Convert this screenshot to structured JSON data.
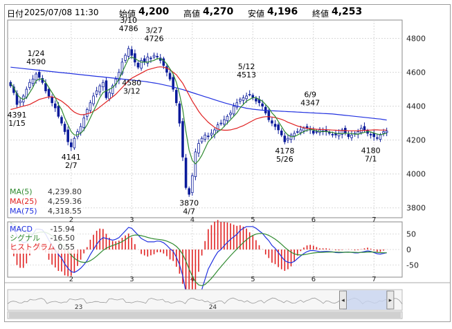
{
  "header": {
    "date_label": "日付",
    "datetime": "2025/07/08 11:30",
    "open_label": "始値",
    "open": "4,200",
    "high_label": "高値",
    "high": "4,270",
    "low_label": "安値",
    "low": "4,196",
    "close_label": "終値",
    "close": "4,253"
  },
  "colors": {
    "up_candle": "#ffffff",
    "down_candle": "#0a1a9a",
    "ma5": "#2f8a2f",
    "ma25": "#e02020",
    "ma75": "#2030e0",
    "macd": "#2030e0",
    "signal": "#2f8a2f",
    "histogram": "#e02020"
  },
  "chart_data": [
    {
      "type": "candlestick",
      "ylim": [
        3750,
        4900
      ],
      "y_ticks": [
        "4800",
        "4600",
        "4400",
        "4200",
        "4000",
        "3800"
      ],
      "x_ticks": [
        "2",
        "3",
        "4",
        "5",
        "6",
        "7"
      ],
      "legend": [
        {
          "name": "MA(5)",
          "value": "4,239.80"
        },
        {
          "name": "MA(25)",
          "value": "4,259.36"
        },
        {
          "name": "MA(75)",
          "value": "4,318.55"
        }
      ],
      "annotations": [
        {
          "date": "1/15",
          "value": "4391"
        },
        {
          "date": "1/24",
          "value": "4590"
        },
        {
          "date": "2/7",
          "value": "4141"
        },
        {
          "date": "3/10",
          "value": "4786"
        },
        {
          "date": "3/12",
          "value": "4580"
        },
        {
          "date": "3/27",
          "value": "4726"
        },
        {
          "date": "4/7",
          "value": "3870"
        },
        {
          "date": "5/12",
          "value": "4513"
        },
        {
          "date": "5/26",
          "value": "4178"
        },
        {
          "date": "6/9",
          "value": "4347"
        },
        {
          "date": "7/1",
          "value": "4180"
        }
      ],
      "closes": [
        4520,
        4480,
        4410,
        4430,
        4460,
        4500,
        4540,
        4560,
        4590,
        4570,
        4540,
        4490,
        4460,
        4420,
        4390,
        4340,
        4300,
        4250,
        4190,
        4160,
        4210,
        4250,
        4280,
        4330,
        4380,
        4420,
        4460,
        4490,
        4520,
        4540,
        4450,
        4480,
        4520,
        4560,
        4600,
        4660,
        4700,
        4740,
        4700,
        4660,
        4630,
        4670,
        4660,
        4690,
        4680,
        4700,
        4690,
        4670,
        4640,
        4600,
        4560,
        4500,
        4420,
        4300,
        4100,
        3920,
        3880,
        3990,
        4130,
        4180,
        4210,
        4230,
        4220,
        4240,
        4260,
        4290,
        4300,
        4320,
        4340,
        4360,
        4400,
        4420,
        4440,
        4450,
        4460,
        4470,
        4450,
        4430,
        4420,
        4400,
        4360,
        4320,
        4300,
        4280,
        4260,
        4230,
        4190,
        4210,
        4230,
        4240,
        4250,
        4260,
        4270,
        4270,
        4260,
        4240,
        4250,
        4260,
        4250,
        4250,
        4240,
        4230,
        4230,
        4240,
        4260,
        4240,
        4220,
        4230,
        4240,
        4250,
        4270,
        4260,
        4240,
        4230,
        4220,
        4210,
        4230,
        4250,
        4253
      ],
      "ma5": [
        4535,
        4510,
        4470,
        4450,
        4440,
        4450,
        4480,
        4510,
        4550,
        4560,
        4560,
        4540,
        4510,
        4480,
        4450,
        4410,
        4380,
        4330,
        4290,
        4250,
        4230,
        4230,
        4240,
        4260,
        4290,
        4330,
        4370,
        4410,
        4450,
        4480,
        4490,
        4500,
        4510,
        4530,
        4560,
        4600,
        4640,
        4680,
        4690,
        4680,
        4670,
        4660,
        4660,
        4660,
        4665,
        4670,
        4680,
        4680,
        4670,
        4650,
        4620,
        4590,
        4540,
        4470,
        4380,
        4250,
        4140,
        4080,
        4060,
        4080,
        4110,
        4150,
        4190,
        4210,
        4230,
        4250,
        4260,
        4280,
        4300,
        4320,
        4340,
        4360,
        4390,
        4410,
        4430,
        4440,
        4450,
        4450,
        4440,
        4430,
        4410,
        4390,
        4360,
        4340,
        4310,
        4280,
        4250,
        4230,
        4220,
        4220,
        4230,
        4240,
        4250,
        4258,
        4262,
        4260,
        4255,
        4250,
        4250,
        4250,
        4248,
        4245,
        4240,
        4238,
        4238,
        4240,
        4240,
        4238,
        4235,
        4235,
        4240,
        4245,
        4250,
        4248,
        4242,
        4235,
        4232,
        4236,
        4240
      ],
      "ma25": [
        4380,
        4385,
        4390,
        4395,
        4400,
        4405,
        4410,
        4420,
        4430,
        4440,
        4445,
        4450,
        4455,
        4455,
        4450,
        4440,
        4430,
        4415,
        4400,
        4380,
        4365,
        4355,
        4350,
        4350,
        4355,
        4360,
        4370,
        4380,
        4395,
        4410,
        4425,
        4440,
        4455,
        4470,
        4490,
        4510,
        4530,
        4550,
        4565,
        4575,
        4585,
        4595,
        4605,
        4615,
        4620,
        4625,
        4630,
        4632,
        4630,
        4625,
        4615,
        4600,
        4585,
        4560,
        4535,
        4500,
        4465,
        4430,
        4400,
        4370,
        4345,
        4325,
        4305,
        4290,
        4275,
        4265,
        4260,
        4258,
        4258,
        4260,
        4265,
        4270,
        4278,
        4285,
        4295,
        4305,
        4315,
        4325,
        4330,
        4335,
        4338,
        4338,
        4336,
        4333,
        4328,
        4322,
        4315,
        4305,
        4298,
        4290,
        4283,
        4278,
        4273,
        4270,
        4268,
        4266,
        4264,
        4263,
        4262,
        4261,
        4260,
        4259,
        4258,
        4257,
        4256,
        4256,
        4255,
        4255,
        4255,
        4255,
        4256,
        4257,
        4258,
        4259,
        4260,
        4260,
        4259,
        4259,
        4259
      ],
      "ma75": [
        4630,
        4628,
        4626,
        4624,
        4622,
        4620,
        4618,
        4616,
        4614,
        4612,
        4610,
        4608,
        4606,
        4604,
        4602,
        4600,
        4598,
        4596,
        4594,
        4592,
        4590,
        4588,
        4586,
        4584,
        4582,
        4580,
        4578,
        4576,
        4574,
        4572,
        4570,
        4568,
        4566,
        4564,
        4562,
        4560,
        4558,
        4556,
        4554,
        4552,
        4550,
        4548,
        4546,
        4543,
        4540,
        4537,
        4534,
        4530,
        4526,
        4522,
        4518,
        4513,
        4508,
        4503,
        4498,
        4492,
        4486,
        4480,
        4474,
        4468,
        4462,
        4456,
        4450,
        4444,
        4438,
        4432,
        4426,
        4420,
        4415,
        4410,
        4405,
        4400,
        4396,
        4392,
        4388,
        4385,
        4382,
        4380,
        4378,
        4376,
        4375,
        4374,
        4373,
        4372,
        4371,
        4370,
        4369,
        4368,
        4367,
        4366,
        4365,
        4364,
        4363,
        4362,
        4361,
        4360,
        4359,
        4358,
        4357,
        4356,
        4355,
        4354,
        4352,
        4350,
        4348,
        4346,
        4344,
        4342,
        4340,
        4338,
        4336,
        4334,
        4332,
        4330,
        4328,
        4326,
        4324,
        4321,
        4318
      ]
    },
    {
      "type": "macd",
      "ylim": [
        -85,
        85
      ],
      "y_ticks": [
        "50",
        "0",
        "-50"
      ],
      "legend": [
        {
          "name": "MACD",
          "value": "-15.94"
        },
        {
          "name": "シグナル",
          "value": "-16.50"
        },
        {
          "name": "ヒストグラム",
          "value": "0.55"
        }
      ]
    },
    {
      "type": "navigator",
      "labels": [
        "23",
        "24"
      ],
      "window_fraction": [
        0.85,
        0.97
      ]
    }
  ]
}
